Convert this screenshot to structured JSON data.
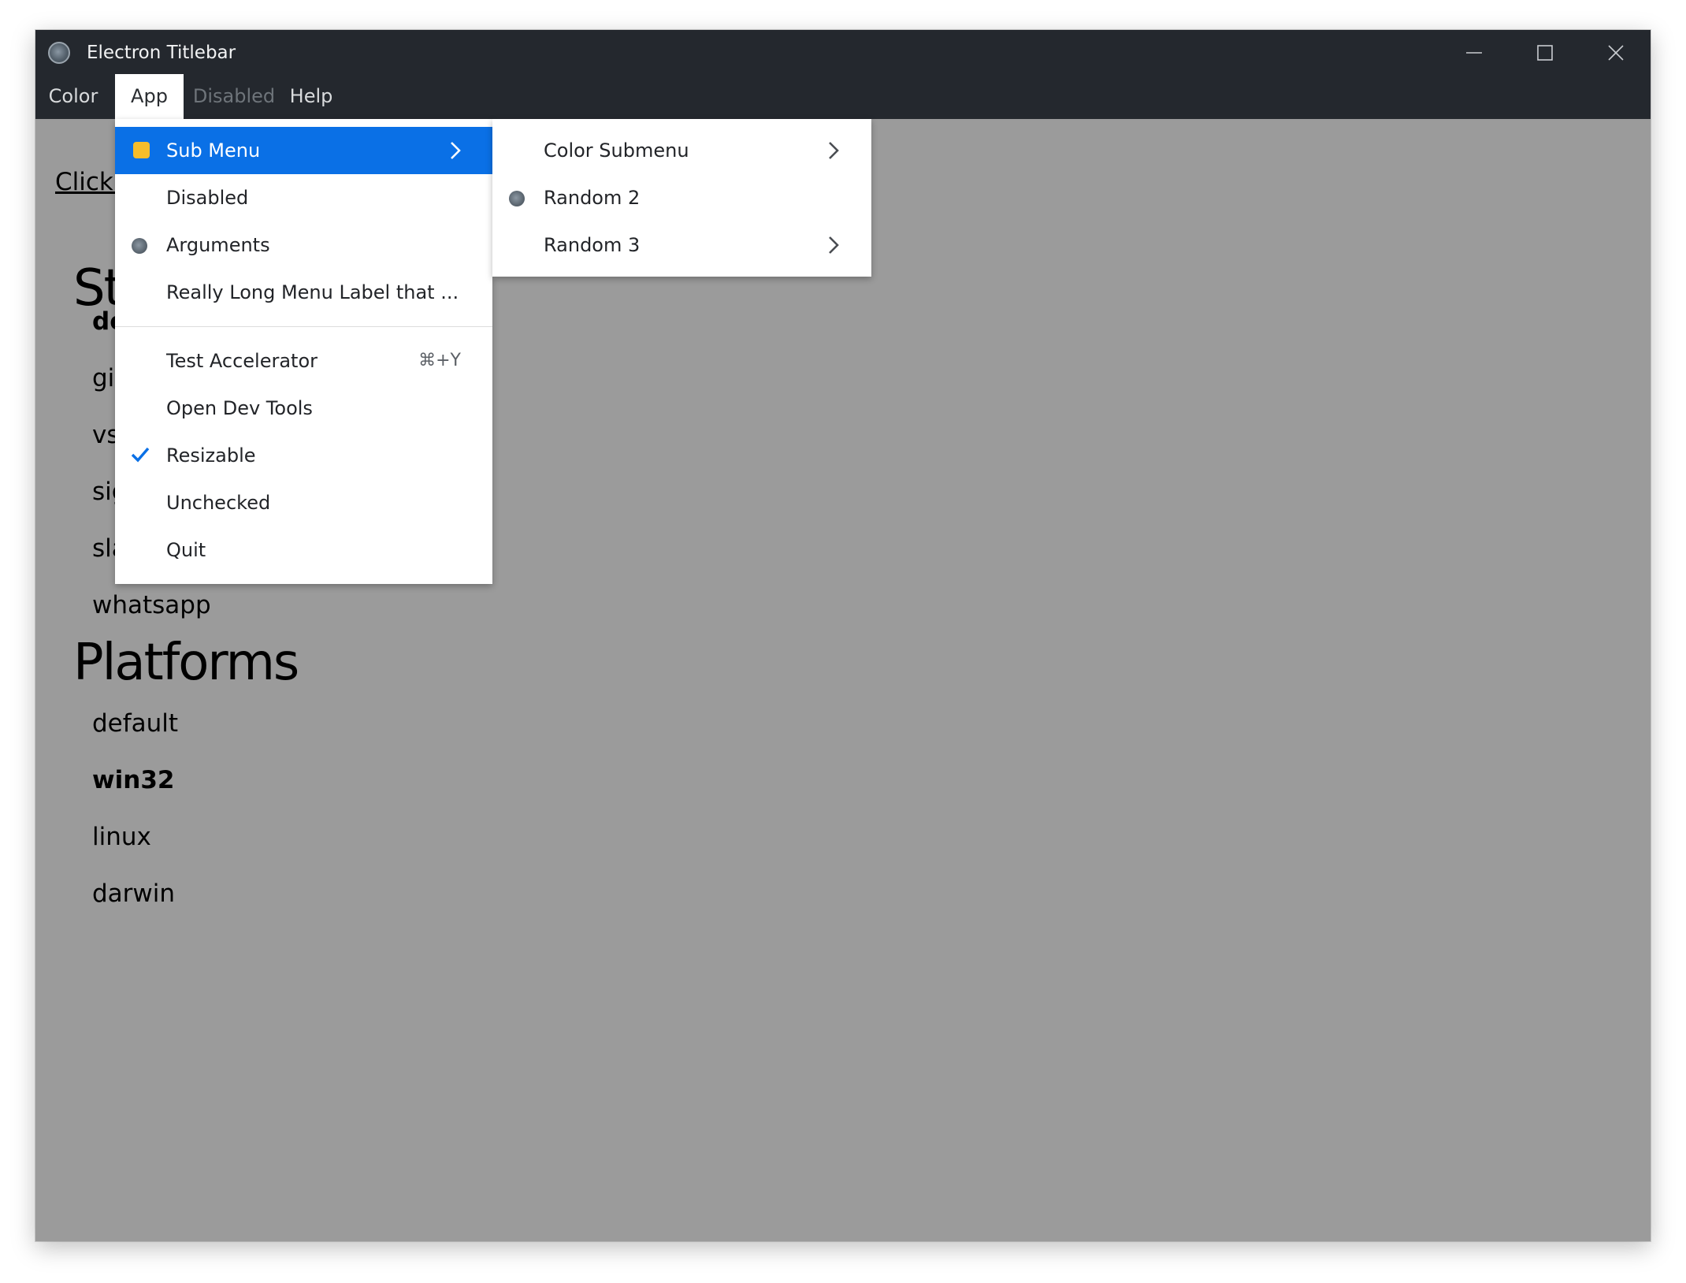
{
  "window": {
    "title": "Electron Titlebar",
    "icon": "electron-atom-icon",
    "controls": [
      "minimize-icon",
      "maximize-icon",
      "close-icon"
    ]
  },
  "menubar": {
    "items": [
      {
        "label": "Color",
        "state": "normal"
      },
      {
        "label": "App",
        "state": "open"
      },
      {
        "label": "Disabled",
        "state": "disabled"
      },
      {
        "label": "Help",
        "state": "normal"
      }
    ]
  },
  "content": {
    "link_text": "Click t",
    "section1_heading": "St",
    "section1_items": [
      "de",
      "git",
      "vs",
      "sig",
      "sla",
      "whatsapp"
    ],
    "section2_heading": "Platforms",
    "section2_items": [
      "default",
      "win32",
      "linux",
      "darwin"
    ]
  },
  "app_menu": {
    "items": [
      {
        "label": "Sub Menu",
        "icon": "bulb-icon",
        "submenu": true,
        "highlighted": true
      },
      {
        "label": "Disabled"
      },
      {
        "label": "Arguments",
        "icon": "electron-radio-icon"
      },
      {
        "label": "Really Long Menu Label that ..."
      },
      {
        "label": "Test Accelerator",
        "accelerator": "⌘+Y"
      },
      {
        "label": "Open Dev Tools"
      },
      {
        "label": "Resizable",
        "checked": true
      },
      {
        "label": "Unchecked"
      },
      {
        "label": "Quit"
      }
    ]
  },
  "submenu": {
    "items": [
      {
        "label": "Color Submenu",
        "submenu": true
      },
      {
        "label": "Random 2",
        "icon": "electron-radio-icon"
      },
      {
        "label": "Random 3",
        "submenu": true
      }
    ]
  },
  "colors": {
    "titlebar": "#24282e",
    "content_bg": "#9b9b9b",
    "highlight": "#0a70e6",
    "check": "#0a70e6",
    "bulb": "#f6bd2b"
  }
}
